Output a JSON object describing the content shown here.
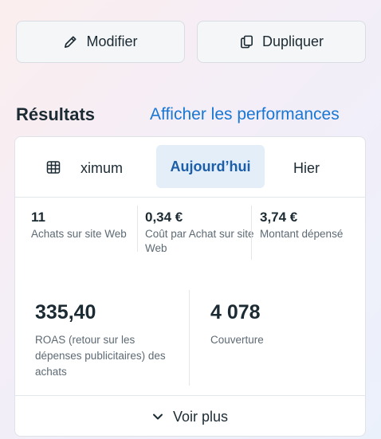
{
  "actions": {
    "edit_label": "Modifier",
    "duplicate_label": "Dupliquer"
  },
  "results": {
    "title": "Résultats",
    "performance_link": "Afficher les performances"
  },
  "tabs": {
    "maximum_label": "ximum",
    "today_label": "Aujourd’hui",
    "yesterday_label": "Hier",
    "selected": "Aujourd’hui"
  },
  "metrics": [
    {
      "value": "11",
      "label": "Achats sur site Web"
    },
    {
      "value": "0,34 €",
      "label": "Coût par Achat sur site Web"
    },
    {
      "value": "3,74 €",
      "label": "Montant dépensé"
    }
  ],
  "big_metrics": [
    {
      "value": "335,40",
      "label": "ROAS (retour sur les dépenses publicitaires) des achats"
    },
    {
      "value": "4 078",
      "label": "Couverture"
    }
  ],
  "see_more_label": "Voir plus",
  "colors": {
    "accent": "#1877d4",
    "selected_tab_bg": "#e3eef9",
    "selected_tab_text": "#1c5ea8"
  },
  "icons": {
    "edit": "pencil-icon",
    "duplicate": "duplicate-icon",
    "calendar": "calendar-grid-icon",
    "chevron": "chevron-down-icon"
  }
}
